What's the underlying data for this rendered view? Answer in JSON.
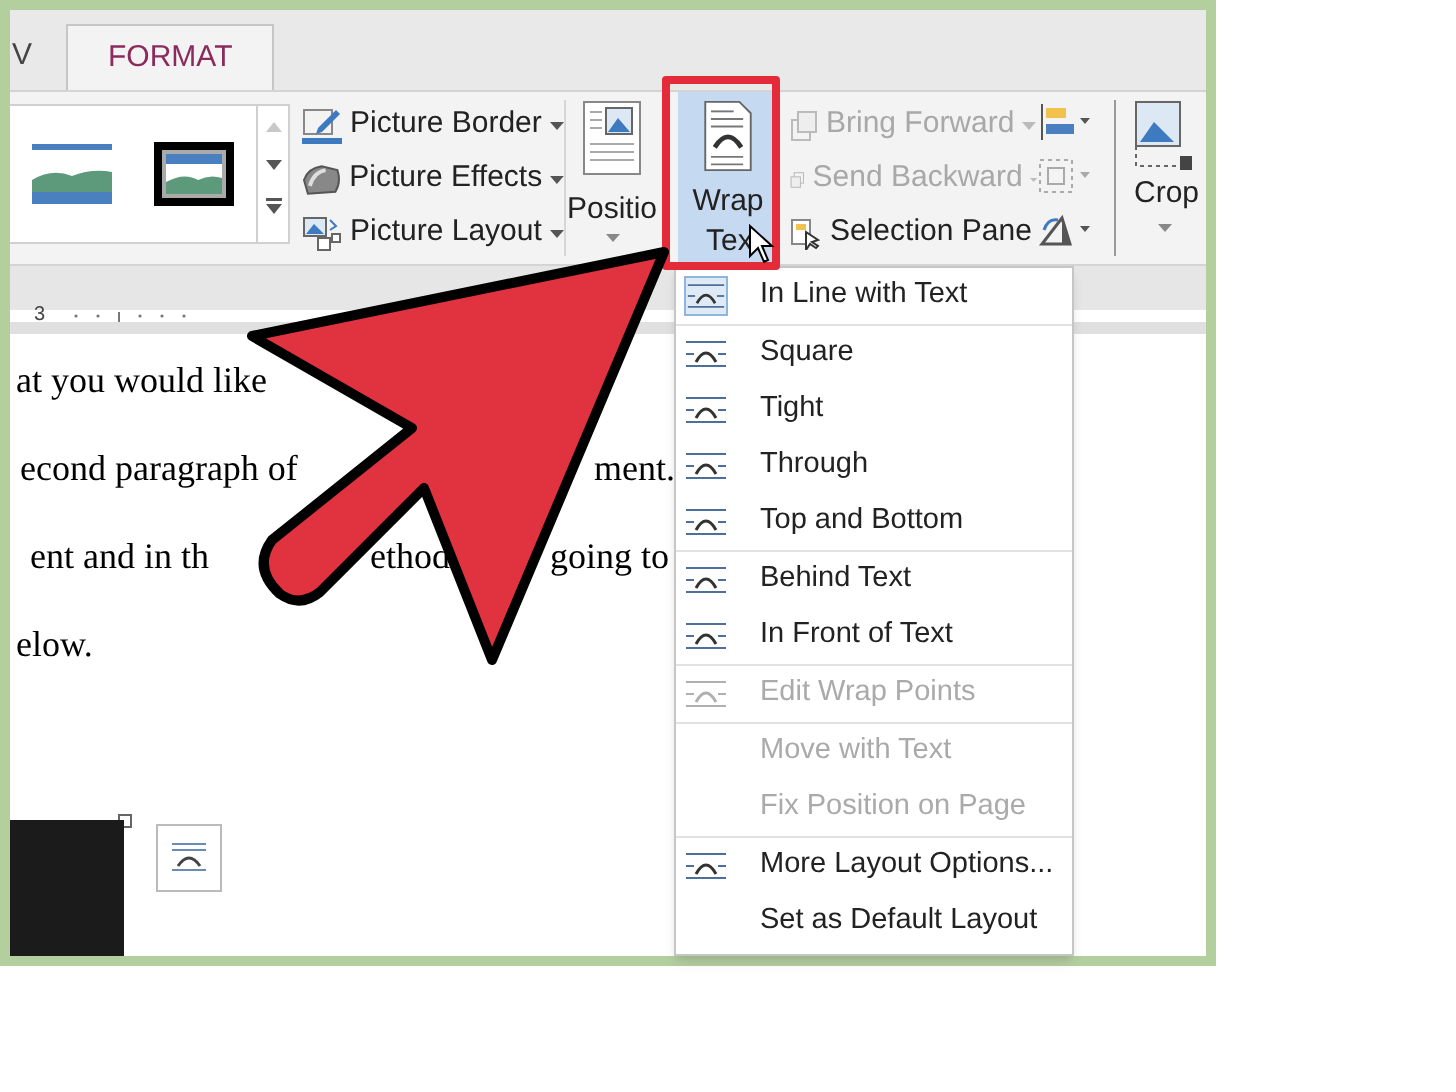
{
  "tabs": [
    {
      "label": "V",
      "selected": false
    },
    {
      "label": "FORMAT",
      "selected": true
    }
  ],
  "picture_commands": [
    {
      "label": "Picture Border",
      "kind": "border"
    },
    {
      "label": "Picture Effects",
      "kind": "effects"
    },
    {
      "label": "Picture Layout",
      "kind": "layout"
    }
  ],
  "position_button": {
    "label": "Positio"
  },
  "wrap_text_button": {
    "label_1": "Wrap",
    "label_2": "Tex",
    "selected": true
  },
  "order_commands": [
    {
      "label": "Bring Forward",
      "disabled": true
    },
    {
      "label": "Send Backward",
      "disabled": true
    },
    {
      "label": "Selection Pane",
      "disabled": false
    }
  ],
  "crop_button": {
    "label": "Crop"
  },
  "ruler": {
    "mark": "3"
  },
  "document_lines": [
    [
      "at you would like"
    ],
    [
      "econd paragraph of",
      "ment."
    ],
    [
      "ent and in th",
      "ethod",
      "going to"
    ],
    [
      "elow."
    ]
  ],
  "wrap_menu": [
    [
      {
        "label": "In Line with Text",
        "kind": "icon",
        "selected": true,
        "disabled": false
      }
    ],
    [
      {
        "label": "Square",
        "kind": "icon",
        "selected": false,
        "disabled": false
      },
      {
        "label": "Tight",
        "kind": "icon",
        "selected": false,
        "disabled": false
      },
      {
        "label": "Through",
        "kind": "icon",
        "selected": false,
        "disabled": false
      },
      {
        "label": "Top and Bottom",
        "kind": "icon",
        "selected": false,
        "disabled": false
      }
    ],
    [
      {
        "label": "Behind Text",
        "kind": "icon",
        "selected": false,
        "disabled": false
      },
      {
        "label": "In Front of Text",
        "kind": "icon",
        "selected": false,
        "disabled": false
      }
    ],
    [
      {
        "label": "Edit Wrap Points",
        "kind": "icon",
        "selected": false,
        "disabled": true
      }
    ],
    [
      {
        "label": "Move with Text",
        "kind": "plain",
        "selected": false,
        "disabled": true
      },
      {
        "label": "Fix Position on Page",
        "kind": "plain",
        "selected": false,
        "disabled": true
      }
    ],
    [
      {
        "label": "More Layout Options...",
        "kind": "icon",
        "selected": false,
        "disabled": false
      },
      {
        "label": "Set as Default Layout",
        "kind": "plain",
        "selected": false,
        "disabled": false
      }
    ]
  ]
}
